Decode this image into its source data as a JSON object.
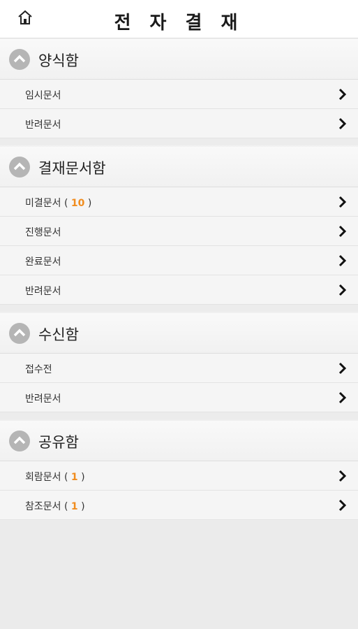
{
  "header": {
    "title": "전 자 결 재"
  },
  "sections": [
    {
      "title": "양식함",
      "items": [
        {
          "label": "임시문서"
        },
        {
          "label": "반려문서"
        }
      ]
    },
    {
      "title": "결재문서함",
      "items": [
        {
          "label": "미결문서",
          "count": "10"
        },
        {
          "label": "진행문서"
        },
        {
          "label": "완료문서"
        },
        {
          "label": "반려문서"
        }
      ]
    },
    {
      "title": "수신함",
      "items": [
        {
          "label": "접수전"
        },
        {
          "label": "반려문서"
        }
      ]
    },
    {
      "title": "공유함",
      "items": [
        {
          "label": "회람문서",
          "count": "1"
        },
        {
          "label": "참조문서",
          "count": "1"
        }
      ]
    }
  ],
  "colors": {
    "count": "#f08c1e",
    "icon_bg": "#b5b5b5"
  }
}
